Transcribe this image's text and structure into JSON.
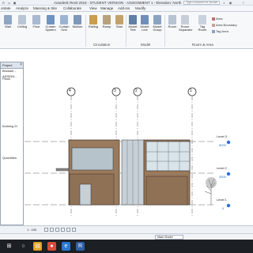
{
  "titlebar": {
    "title": "Autodesk Revit 2018 - STUDENT VERSION -   ASSIGNMENT 1 - Elevation: North",
    "search_placeholder": "Type a keyword or phrase"
  },
  "tabs": [
    "ontate",
    "Analyze",
    "Massing & Site",
    "Collaborate",
    "View",
    "Manage",
    "Add-ins",
    "Modify"
  ],
  "active_tab": "Architecture",
  "ribbon": {
    "tools": [
      {
        "label": "Wall",
        "color": "#8fa6c4"
      },
      {
        "label": "Ceiling",
        "color": "#b9c6d6"
      },
      {
        "label": "Floor",
        "color": "#a9b9cf"
      },
      {
        "label": "Curtain System",
        "color": "#6f93c2"
      },
      {
        "label": "Curtain Grid",
        "color": "#9cb4d4"
      },
      {
        "label": "Mullion",
        "color": "#7f98b9"
      },
      {
        "label": "Railing",
        "color": "#c99d4e"
      },
      {
        "label": "Ramp",
        "color": "#b7a27a"
      },
      {
        "label": "Stair",
        "color": "#c4a36a"
      },
      {
        "label": "Model Text",
        "color": "#5f7fa8"
      },
      {
        "label": "Model Line",
        "color": "#6d8fbb"
      },
      {
        "label": "Model Group",
        "color": "#8aa3c2"
      },
      {
        "label": "Room",
        "color": "#b8c4d3"
      },
      {
        "label": "Room Separator",
        "color": "#c7ced9"
      },
      {
        "label": "Tag Room",
        "color": "#c9d1dc"
      }
    ],
    "room_area_items": [
      "Area",
      "Area Boundary",
      "Tag Area"
    ],
    "panels": [
      "Circulation",
      "Model",
      "Room & Area"
    ]
  },
  "side_panel": {
    "title": "Project Browser - ASSIGN...",
    "items": [
      "Plans",
      "Building El",
      "Quantities"
    ]
  },
  "drawing": {
    "grids": [
      "4",
      "3",
      "2",
      "1"
    ],
    "levels": [
      {
        "name": "Level 3",
        "elevation": "8000"
      },
      {
        "name": "Level 2",
        "elevation": "4500"
      },
      {
        "name": "Level 1",
        "elevation": "0"
      }
    ]
  },
  "view_bar": {
    "scale": "1 : 100"
  },
  "status_bar": {
    "model": "Main Model"
  },
  "taskbar": [
    {
      "name": "windows",
      "glyph": "⊞",
      "color": "#1c1f24"
    },
    {
      "name": "search",
      "glyph": "○",
      "color": "#1c1f24"
    },
    {
      "name": "explorer",
      "glyph": "▤",
      "color": "#e0a526"
    },
    {
      "name": "chrome",
      "glyph": "●",
      "color": "#d94c3a"
    },
    {
      "name": "edge",
      "glyph": "e",
      "color": "#2a7ad1"
    },
    {
      "name": "revit",
      "glyph": "R",
      "color": "#2f5fa8"
    }
  ]
}
